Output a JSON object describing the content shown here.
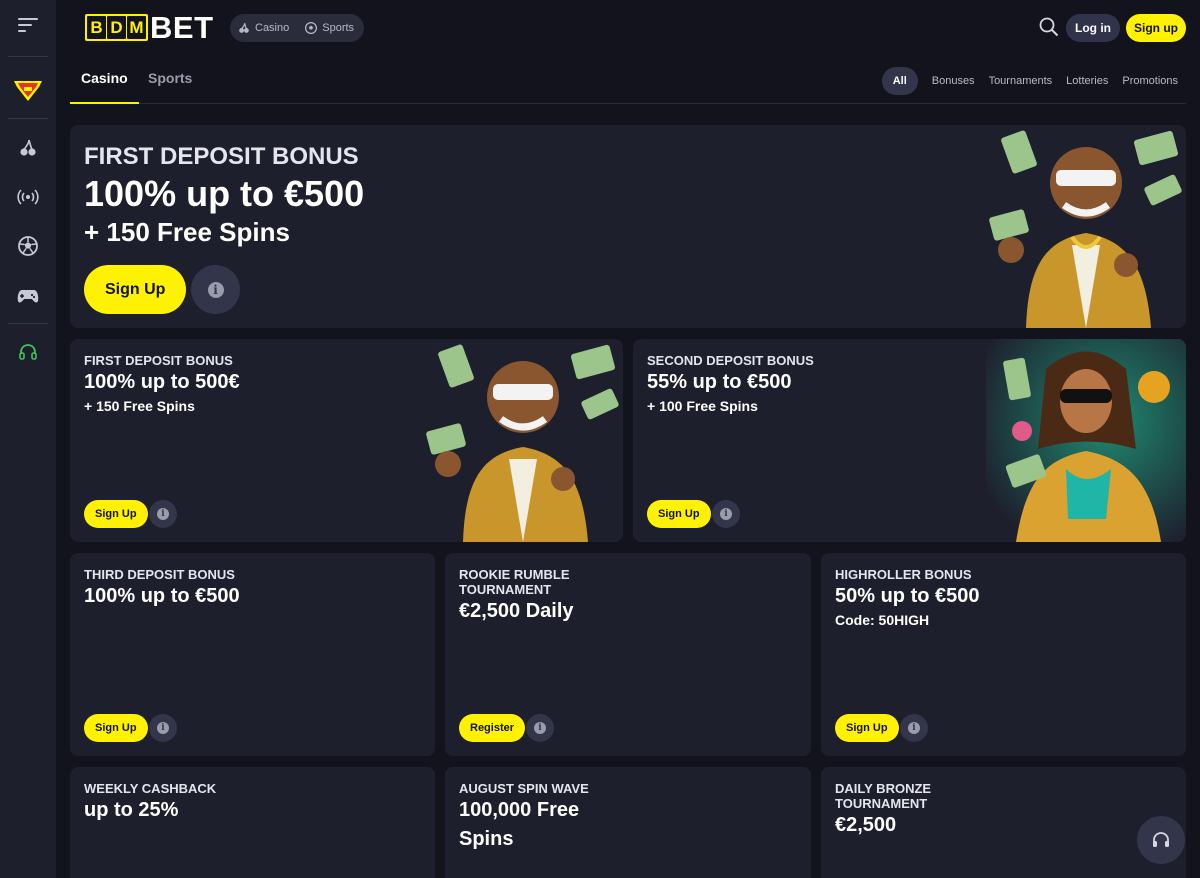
{
  "colors": {
    "accent": "#fff200",
    "background": "#13131d",
    "card": "#1e1f2c",
    "support_icon": "#3ec25a"
  },
  "sidebar": {
    "items": [
      {
        "icon": "menu-icon"
      },
      {
        "icon": "shield-badge-icon"
      },
      {
        "icon": "cherries-icon"
      },
      {
        "icon": "live-broadcast-icon"
      },
      {
        "icon": "soccer-ball-icon"
      },
      {
        "icon": "gamepad-icon"
      },
      {
        "icon": "headset-icon"
      }
    ]
  },
  "header": {
    "logo": {
      "letters": [
        "B",
        "D",
        "M"
      ],
      "suffix": "BET"
    },
    "segments": [
      {
        "label": "Casino",
        "icon": "cherries-icon"
      },
      {
        "label": "Sports",
        "icon": "soccer-ball-icon"
      }
    ],
    "search_icon": "search-icon",
    "login_label": "Log in",
    "signup_label": "Sign up"
  },
  "subnav": {
    "tabs": [
      {
        "label": "Casino",
        "active": true
      },
      {
        "label": "Sports",
        "active": false
      }
    ],
    "filters": [
      {
        "label": "All",
        "active": true
      },
      {
        "label": "Bonuses"
      },
      {
        "label": "Tournaments"
      },
      {
        "label": "Lotteries"
      },
      {
        "label": "Promotions"
      }
    ]
  },
  "hero": {
    "label": "FIRST DEPOSIT BONUS",
    "headline": "100% up to €500",
    "sub": "+ 150 Free Spins",
    "button": "Sign Up"
  },
  "promos": [
    {
      "label": "FIRST DEPOSIT BONUS",
      "headline": "100% up to 500€",
      "sub": "+ 150 Free Spins",
      "button": "Sign Up"
    },
    {
      "label": "SECOND DEPOSIT BONUS",
      "headline": "55% up to €500",
      "sub": "+ 100 Free Spins",
      "button": "Sign Up"
    },
    {
      "label": "THIRD DEPOSIT BONUS",
      "headline": "100% up to €500",
      "sub": "",
      "button": "Sign Up"
    },
    {
      "label": "ROOKIE RUMBLE TOURNAMENT",
      "headline": "€2,500 Daily",
      "sub": "",
      "button": "Register"
    },
    {
      "label": "HIGHROLLER BONUS",
      "headline": "50% up to €500",
      "sub": "Code: 50HIGH",
      "button": "Sign Up"
    },
    {
      "label": "WEEKLY CASHBACK",
      "headline": "up to 25%",
      "sub": ""
    },
    {
      "label": "AUGUST SPIN WAVE",
      "headline": "100,000 Free Spins",
      "sub": ""
    },
    {
      "label": "DAILY BRONZE TOURNAMENT",
      "headline": "€2,500",
      "sub": ""
    }
  ],
  "support_icon": "headset-icon"
}
